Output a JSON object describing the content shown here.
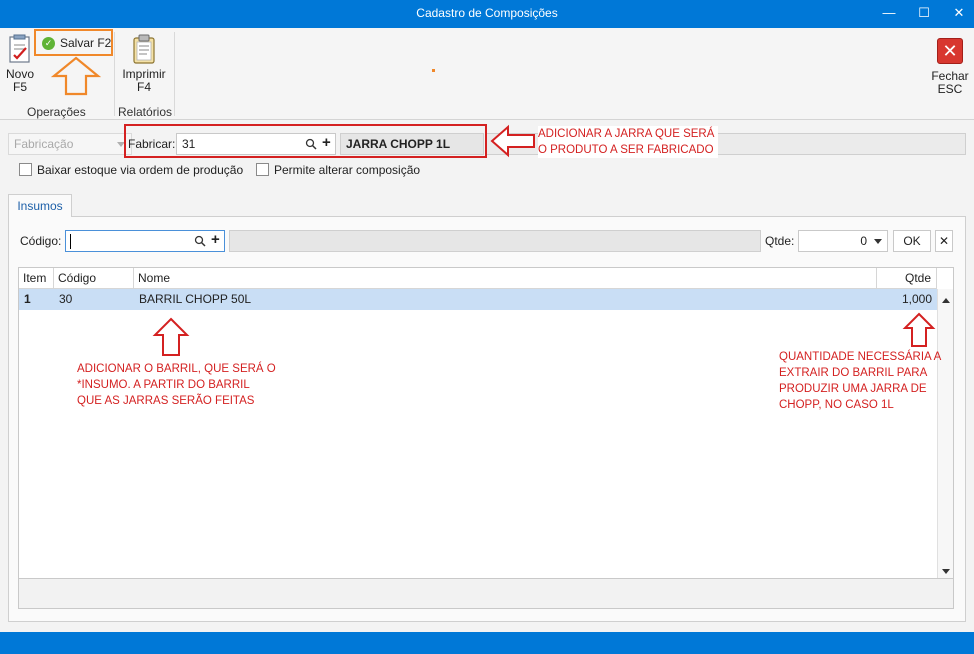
{
  "window": {
    "title": "Cadastro de Composições",
    "minimize": "—",
    "maximize": "☐",
    "close": "✕"
  },
  "ribbon": {
    "novo_label": "Novo",
    "novo_key": "F5",
    "salvar_label": "Salvar F2",
    "imprimir_label": "Imprimir",
    "imprimir_key": "F4",
    "fechar_label": "Fechar",
    "fechar_key": "ESC",
    "group_operacoes": "Operações",
    "group_relatorios": "Relatórios"
  },
  "form": {
    "tipo_value": "Fabricação",
    "fabricar_label": "Fabricar:",
    "fabricar_code": "31",
    "fabricar_name": "JARRA CHOPP 1L",
    "baixar_estoque_label": "Baixar estoque via ordem de produção",
    "baixar_estoque_checked": false,
    "permite_alterar_label": "Permite alterar composição",
    "permite_alterar_checked": false
  },
  "tabs": [
    {
      "label": "Insumos",
      "active": true
    }
  ],
  "insumos": {
    "codigo_label": "Código:",
    "codigo_value": "",
    "qtde_label": "Qtde:",
    "qtde_value": "0",
    "ok_label": "OK",
    "remove_label": "✕"
  },
  "grid": {
    "columns": [
      "Item",
      "Código",
      "Nome",
      "Qtde"
    ],
    "rows": [
      {
        "item": "1",
        "codigo": "30",
        "nome": "BARRIL CHOPP 50L",
        "qtde": "1,000"
      }
    ]
  },
  "annotations": {
    "fabricar_note_1": "ADICIONAR A JARRA QUE SERÁ",
    "fabricar_note_2": "O PRODUTO A SER FABRICADO",
    "insumo_note_1": "ADICIONAR O BARRIL, QUE SERÁ O",
    "insumo_note_2": "*INSUMO. A PARTIR DO BARRIL",
    "insumo_note_3": "QUE AS JARRAS SERÃO FEITAS",
    "qtde_note_1": "QUANTIDADE NECESSÁRIA A",
    "qtde_note_2": "EXTRAIR DO BARRIL PARA",
    "qtde_note_3": "PRODUZIR UMA JARRA DE",
    "qtde_note_4": "CHOPP, NO CASO 1L"
  },
  "colors": {
    "titlebar": "#0078d7",
    "annotation_red": "#d42121",
    "annotation_orange": "#f0882a",
    "row_selected": "#c9def5"
  }
}
